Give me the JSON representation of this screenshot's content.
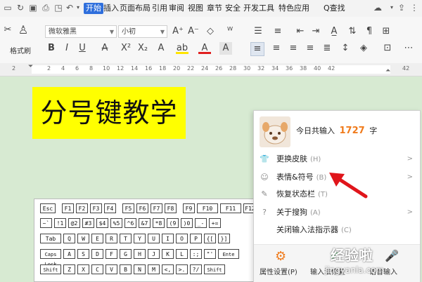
{
  "menubar": {
    "tabs": [
      "开始",
      "插入",
      "页面布局",
      "引用",
      "审阅",
      "视图",
      "章节",
      "安全",
      "开发工具",
      "特色应用"
    ],
    "search": "Q查找"
  },
  "toolbar": {
    "paste_label": "格式刷",
    "font_name": "微软雅黑",
    "font_size": "小初"
  },
  "ruler": {
    "numbers": [
      "8",
      "6",
      "4",
      "2",
      "2",
      "4",
      "6",
      "8",
      "10",
      "12",
      "14",
      "16",
      "18",
      "20",
      "22",
      "24",
      "26",
      "28",
      "30",
      "32",
      "34",
      "36",
      "38",
      "40",
      "42"
    ]
  },
  "document": {
    "title": "分号键教学",
    "highlight_color": "#ffff00"
  },
  "keyboard": {
    "row1": [
      "Esc",
      "F1",
      "F2",
      "F3",
      "F4",
      "F5",
      "F6",
      "F7",
      "F8",
      "F9",
      "F10",
      "F11",
      "F12"
    ],
    "row2": [
      "~`",
      "!1",
      "@2",
      "#3",
      "$4",
      "%5",
      "^6",
      "&7",
      "*8",
      "(9",
      ")0",
      "_-",
      "+="
    ],
    "row3": [
      "Tab",
      "Q",
      "W",
      "E",
      "R",
      "T",
      "Y",
      "U",
      "I",
      "O",
      "P",
      "{[",
      "}]"
    ],
    "row4": [
      "Caps Lock",
      "A",
      "S",
      "D",
      "F",
      "G",
      "H",
      "J",
      "K",
      "L",
      ":;",
      "\"'",
      "Ente"
    ],
    "row5": [
      "Shift",
      "Z",
      "X",
      "C",
      "V",
      "B",
      "N",
      "M",
      "<,",
      ">.",
      "?/",
      "Shift"
    ]
  },
  "ime": {
    "today_prefix": "今日共输入",
    "today_count": "1727",
    "today_suffix": "字",
    "count_color": "#f07b1c",
    "items": [
      {
        "label": "更换皮肤",
        "shortcut": "(H)",
        "icon": "shirt-icon",
        "has_arrow": true
      },
      {
        "label": "表情&符号",
        "shortcut": "(B)",
        "icon": "smiley-icon",
        "has_arrow": true
      },
      {
        "label": "恢复状态栏",
        "shortcut": "(T)",
        "icon": "statusbar-icon",
        "has_arrow": false
      },
      {
        "label": "关于搜狗",
        "shortcut": "(A)",
        "icon": "help-icon",
        "has_arrow": true
      },
      {
        "label": "关闭输入法指示器",
        "shortcut": "(C)",
        "icon": "",
        "has_arrow": false
      }
    ],
    "bottom": {
      "settings": "属性设置(P)",
      "repair": "输入法修复",
      "voice": "语音输入"
    }
  },
  "watermark": {
    "line1": "经验啦",
    "line2": "jingyanla.com"
  }
}
